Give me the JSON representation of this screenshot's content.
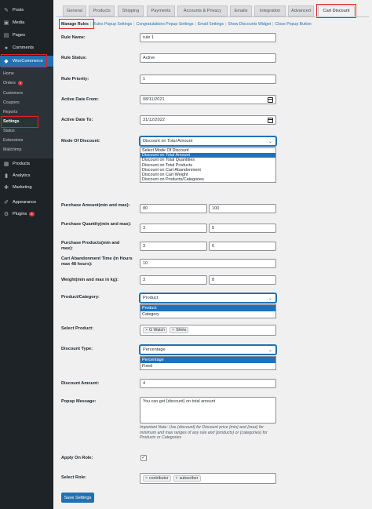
{
  "sidebar": {
    "items_top": [
      {
        "label": "Posts",
        "icon": "posts-icon",
        "glyph": "✎"
      },
      {
        "label": "Media",
        "icon": "media-icon",
        "glyph": "▣"
      },
      {
        "label": "Pages",
        "icon": "pages-icon",
        "glyph": "▤"
      },
      {
        "label": "Comments",
        "icon": "comments-icon",
        "glyph": "●"
      }
    ],
    "woocommerce": {
      "label": "WooCommerce",
      "glyph": "◆"
    },
    "sub_items": [
      {
        "label": "Home"
      },
      {
        "label": "Orders",
        "badge": "1"
      },
      {
        "label": "Customers"
      },
      {
        "label": "Coupons"
      },
      {
        "label": "Reports"
      },
      {
        "label": "Settings"
      },
      {
        "label": "Status"
      },
      {
        "label": "Extensions"
      },
      {
        "label": "Mailchimp"
      }
    ],
    "items_bottom": [
      {
        "label": "Products",
        "icon": "products-icon",
        "glyph": "▦"
      },
      {
        "label": "Analytics",
        "icon": "analytics-icon",
        "glyph": "▮"
      },
      {
        "label": "Marketing",
        "icon": "marketing-icon",
        "glyph": "✚"
      },
      {
        "label": "Appearance",
        "icon": "appearance-icon",
        "glyph": "✐"
      },
      {
        "label": "Plugins",
        "icon": "plugins-icon",
        "glyph": "⚙",
        "badge": "6"
      }
    ]
  },
  "tabs": [
    "General",
    "Products",
    "Shipping",
    "Payments",
    "Accounts & Privacy",
    "Emails",
    "Integration",
    "Advanced",
    "Cart Discount"
  ],
  "sublinks": [
    "Manage Rules",
    "Rules Popup Settings",
    "Congratulations Popup Settings",
    "Email Settings",
    "Show Discounts Widget",
    "Close Popup Button"
  ],
  "form": {
    "rule_name": {
      "label": "Rule Name:",
      "value": "rule 1"
    },
    "rule_status": {
      "label": "Rule Status:",
      "value": "Active"
    },
    "rule_priority": {
      "label": "Rule Priority:",
      "value": "1"
    },
    "active_from": {
      "label": "Active Date From:",
      "value": "08/11/2021"
    },
    "active_to": {
      "label": "Active Date To:",
      "value": "31/12/2022"
    },
    "mode": {
      "label": "Mode Of Discount:",
      "value": "Discount on Total Amount",
      "options": [
        "Select Mode Of Discount",
        "Discount on Total Amount",
        "Discount on Total Quantities",
        "Discount on Total Products",
        "Discount on Cart Abandonment",
        "Discount on Cart Weight",
        "Discount on Products/Categories"
      ],
      "selected_index": 1
    },
    "purchase_amount": {
      "label": "Purchase Amount(min and max):",
      "min": "80",
      "max": "100"
    },
    "purchase_quantity": {
      "label": "Purchase Quantity(min and max):",
      "min": "3",
      "max": "5"
    },
    "purchase_products": {
      "label": "Purchase Products(min and max):",
      "min": "3",
      "max": "6"
    },
    "cart_abandonment": {
      "label": "Cart Abandonment Time (in Hours max 48 hours):",
      "value": "10"
    },
    "weight": {
      "label": "Weight(min and max in kg):",
      "min": "3",
      "max": "8"
    },
    "product_category": {
      "label": "Product/Category:",
      "value": "Product",
      "options": [
        "Product",
        "Category"
      ],
      "selected_index": 0
    },
    "select_product": {
      "label": "Select Product:",
      "tags": [
        "G Watch",
        "Shirts"
      ]
    },
    "discount_type": {
      "label": "Discount Type:",
      "value": "Percentage",
      "options": [
        "Percentage",
        "Fixed"
      ],
      "selected_index": 0
    },
    "discount_amount": {
      "label": "Discount Amount:",
      "value": "4"
    },
    "popup_message": {
      "label": "Popup Message:",
      "value": "You can get {discount} on total amount",
      "note": "Important Note: Use {discount} for Discount price {min} and {max} for minimum and max ranges of any rule and {products} or {categories} for Products or Categories"
    },
    "apply_on_role": {
      "label": "Apply On Role:",
      "checked": true
    },
    "select_role": {
      "label": "Select Role:",
      "tags": [
        "contributor",
        "subscriber"
      ]
    },
    "save_label": "Save Settings"
  }
}
